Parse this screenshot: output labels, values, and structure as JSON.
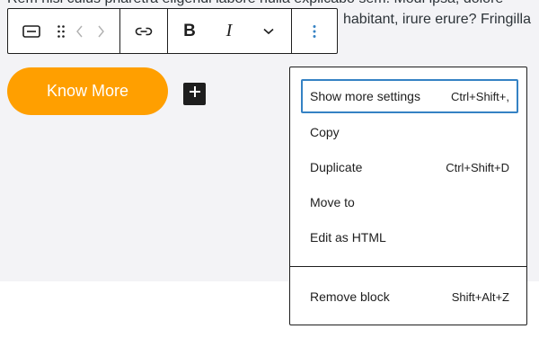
{
  "paragraph": {
    "line_top": "Rem nisi culus pharetra eligendi labore nulla explicabo sem. Modi ipsa, dolore",
    "line_right": "habitant, irure erure? Fringilla"
  },
  "toolbar": {
    "buttons": [
      {
        "icon": "button-block-icon"
      },
      {
        "icon": "drag-handle-icon"
      },
      {
        "icon": "move-left-icon"
      },
      {
        "icon": "move-right-icon"
      },
      {
        "icon": "link-icon"
      },
      {
        "label": "B",
        "icon": "bold-icon"
      },
      {
        "label": "I",
        "icon": "italic-icon"
      },
      {
        "icon": "chevron-down-icon"
      },
      {
        "icon": "more-options-icon"
      }
    ]
  },
  "button_block": {
    "label": "Know More",
    "background": "#ff9f00",
    "text_color": "#ffffff"
  },
  "inserter": {
    "icon": "plus-icon"
  },
  "menu": {
    "groups": [
      {
        "items": [
          {
            "label": "Show more settings",
            "shortcut": "Ctrl+Shift+,",
            "focused": true
          },
          {
            "label": "Copy",
            "shortcut": ""
          },
          {
            "label": "Duplicate",
            "shortcut": "Ctrl+Shift+D"
          },
          {
            "label": "Move to",
            "shortcut": ""
          },
          {
            "label": "Edit as HTML",
            "shortcut": ""
          }
        ]
      },
      {
        "items": [
          {
            "label": "Remove block",
            "shortcut": "Shift+Alt+Z"
          }
        ]
      }
    ],
    "focus_color": "#3582c4"
  }
}
